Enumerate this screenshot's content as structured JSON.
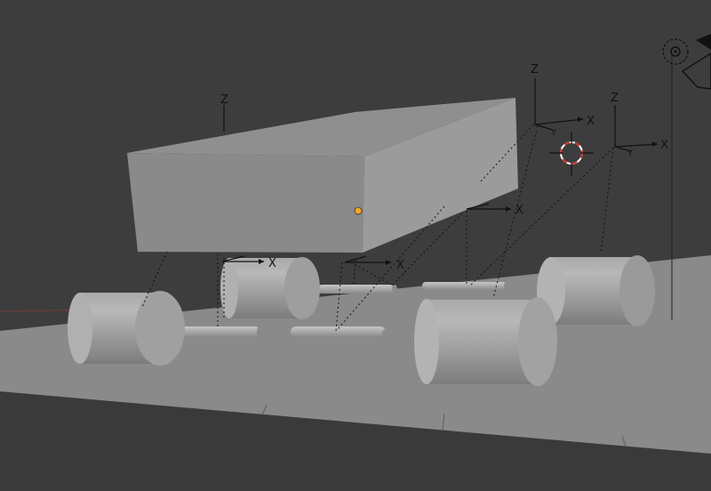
{
  "viewport": {
    "background_color": "#3d3d3d",
    "ground_color": "#8a8a8a",
    "origin_dot_color": "#f5a623",
    "cursor_color": "#d0312d"
  },
  "axis_labels": {
    "z": "Z",
    "x": "X",
    "y": "Y"
  },
  "icons": {
    "camera": "camera-icon",
    "light": "light-icon",
    "cursor": "3d-cursor-icon"
  }
}
